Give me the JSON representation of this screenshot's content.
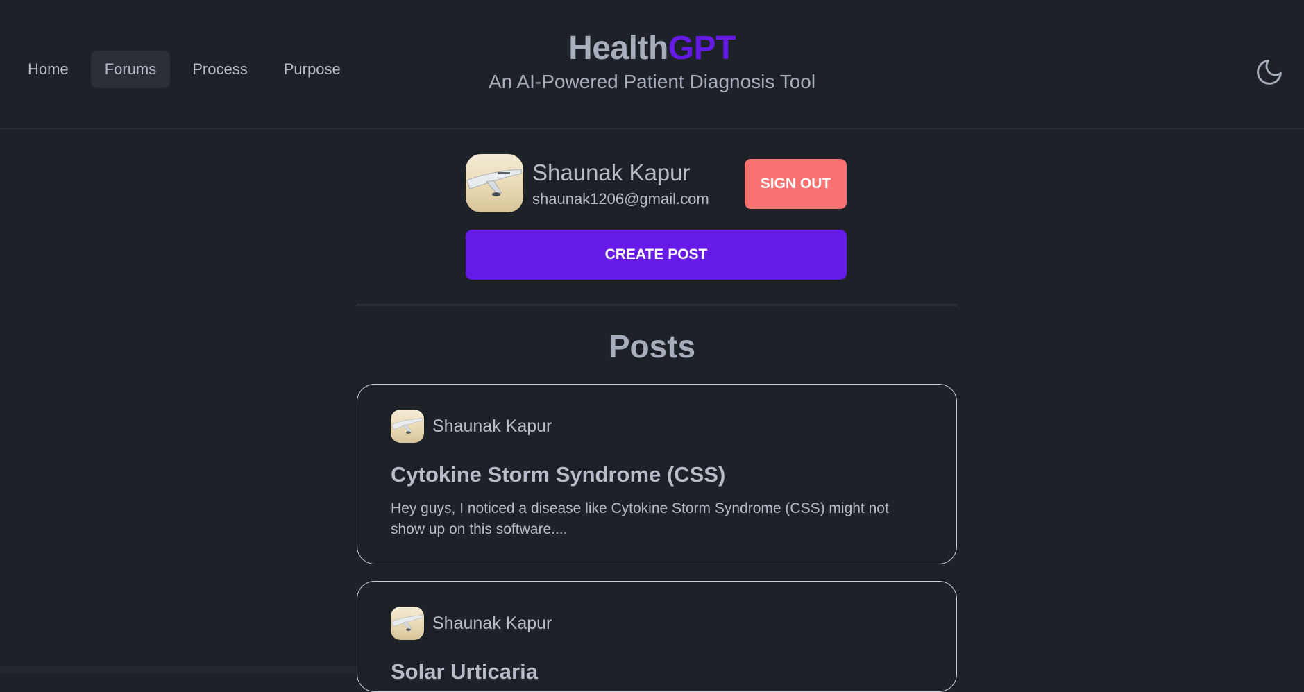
{
  "nav": {
    "items": [
      {
        "label": "Home",
        "active": false
      },
      {
        "label": "Forums",
        "active": true
      },
      {
        "label": "Process",
        "active": false
      },
      {
        "label": "Purpose",
        "active": false
      }
    ]
  },
  "brand": {
    "title_main": "Health",
    "title_accent": "GPT",
    "subtitle": "An AI-Powered Patient Diagnosis Tool"
  },
  "theme_toggle": {
    "icon": "moon-icon"
  },
  "profile": {
    "name": "Shaunak Kapur",
    "email": "shaunak1206@gmail.com",
    "sign_out_label": "SIGN OUT",
    "avatar_icon": "airplane-avatar"
  },
  "create_post_label": "CREATE POST",
  "posts_heading": "Posts",
  "posts": [
    {
      "author": "Shaunak Kapur",
      "title": "Cytokine Storm Syndrome (CSS)",
      "excerpt": "Hey guys, I noticed a disease like Cytokine Storm Syndrome (CSS) might not show up on this software...."
    },
    {
      "author": "Shaunak Kapur",
      "title": "Solar Urticaria",
      "excerpt": ""
    }
  ],
  "colors": {
    "background": "#1d2128",
    "accent": "#661ae6",
    "sign_out": "#f87272",
    "text": "#a6adbb"
  }
}
